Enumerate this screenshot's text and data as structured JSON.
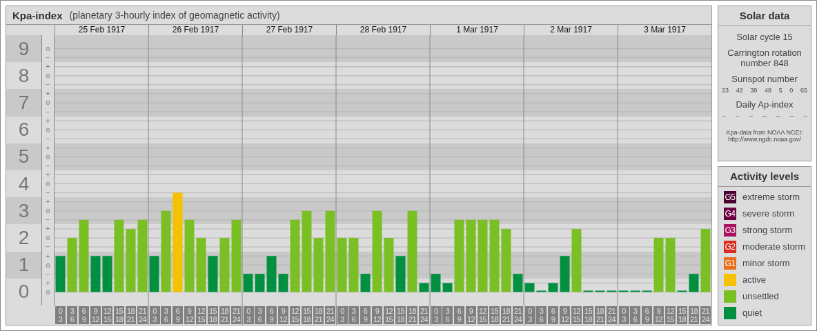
{
  "panel": {
    "title": "Kpa-index",
    "subtitle": "(planetary 3-hourly index of geomagnetic activity)"
  },
  "chart": {
    "days": [
      "25 Feb 1917",
      "26 Feb 1917",
      "27 Feb 1917",
      "28 Feb 1917",
      "1 Mar 1917",
      "2 Mar 1917",
      "3 Mar 1917"
    ],
    "sub_ticks": [
      "o",
      "−",
      "+",
      "o",
      "−",
      "+",
      "o",
      "−",
      "+",
      "o",
      "−",
      "+",
      "o",
      "−",
      "+",
      "o",
      "−",
      "+",
      "o",
      "−",
      "+",
      "o",
      "−",
      "+",
      "o",
      "−",
      "+",
      "o"
    ],
    "chart_data": {
      "type": "bar",
      "grid": true,
      "ylim": [
        -0.5,
        9.5
      ],
      "yticks": [
        0,
        1,
        2,
        3,
        4,
        5,
        6,
        7,
        8,
        9
      ],
      "categories": [
        "0 3",
        "3 6",
        "6 9",
        "9 12",
        "12 15",
        "15 18",
        "18 21",
        "21 24",
        "0 3",
        "3 6",
        "6 9",
        "9 12",
        "12 15",
        "15 18",
        "18 21",
        "21 24",
        "0 3",
        "3 6",
        "6 9",
        "9 12",
        "12 15",
        "15 18",
        "18 21",
        "21 24",
        "0 3",
        "3 6",
        "6 9",
        "9 12",
        "12 15",
        "15 18",
        "18 21",
        "21 24",
        "0 3",
        "3 6",
        "6 9",
        "9 12",
        "12 15",
        "15 18",
        "18 21",
        "21 24",
        "0 3",
        "3 6",
        "6 9",
        "9 12",
        "12 15",
        "15 18",
        "18 21",
        "21 24",
        "0 3",
        "3 6",
        "6 9",
        "9 12",
        "12 15",
        "15 18",
        "18 21",
        "21 24"
      ],
      "series": [
        {
          "name": "active",
          "color": "#f5c200",
          "values": [
            null,
            null,
            null,
            null,
            null,
            null,
            null,
            null,
            null,
            null,
            3.67,
            null,
            null,
            null,
            null,
            null,
            null,
            null,
            null,
            null,
            null,
            null,
            null,
            null,
            null,
            null,
            null,
            null,
            null,
            null,
            null,
            null,
            null,
            null,
            null,
            null,
            null,
            null,
            null,
            null,
            null,
            null,
            null,
            null,
            null,
            null,
            null,
            null,
            null,
            null,
            null,
            null,
            null,
            null,
            null,
            null
          ]
        },
        {
          "name": "unsettled",
          "color": "#7ac025",
          "values": [
            null,
            2,
            2.67,
            null,
            null,
            2.67,
            2.33,
            2.67,
            null,
            3,
            null,
            2.67,
            2,
            null,
            2,
            2.67,
            null,
            null,
            null,
            null,
            2.67,
            3,
            2,
            3,
            2,
            2,
            null,
            3,
            2,
            null,
            3,
            null,
            null,
            null,
            2.67,
            2.67,
            2.67,
            2.67,
            2.33,
            null,
            null,
            null,
            null,
            null,
            2.33,
            null,
            null,
            null,
            null,
            null,
            null,
            2,
            2,
            null,
            null,
            2.33
          ]
        },
        {
          "name": "quiet",
          "color": "#009040",
          "values": [
            1.33,
            null,
            null,
            1.33,
            1.33,
            null,
            null,
            null,
            1.33,
            null,
            null,
            null,
            null,
            1.33,
            null,
            null,
            0.67,
            0.67,
            1.33,
            0.67,
            null,
            null,
            null,
            null,
            null,
            null,
            0.67,
            null,
            null,
            1.33,
            null,
            0.33,
            0.67,
            0.33,
            null,
            null,
            null,
            null,
            null,
            0.67,
            0.33,
            0,
            0.33,
            1.33,
            null,
            0,
            0,
            0,
            0,
            0,
            0,
            null,
            null,
            0,
            0.67,
            null
          ]
        }
      ]
    }
  },
  "solar": {
    "title": "Solar data",
    "cycle": "Solar cycle 15",
    "carrington": "Carrington rotation number 848",
    "sunspot_label": "Sunspot number",
    "sunspots": [
      "23",
      "42",
      "38",
      "48",
      "5",
      "0",
      "65"
    ],
    "ap_label": "Daily Ap-index",
    "ap": [
      "--",
      "--",
      "--",
      "--",
      "--",
      "--",
      "--"
    ],
    "source": "Kpa-data from NOAA NCEI: http://www.ngdc.noaa.gov/"
  },
  "legend": {
    "title": "Activity levels",
    "items": [
      {
        "badge": "G5",
        "label": "extreme storm",
        "color": "#4a0030"
      },
      {
        "badge": "G4",
        "label": "severe storm",
        "color": "#6b0040"
      },
      {
        "badge": "G3",
        "label": "strong storm",
        "color": "#a8125e"
      },
      {
        "badge": "G2",
        "label": "moderate storm",
        "color": "#d82c1c"
      },
      {
        "badge": "G1",
        "label": "minor storm",
        "color": "#e8701c"
      }
    ]
  }
}
